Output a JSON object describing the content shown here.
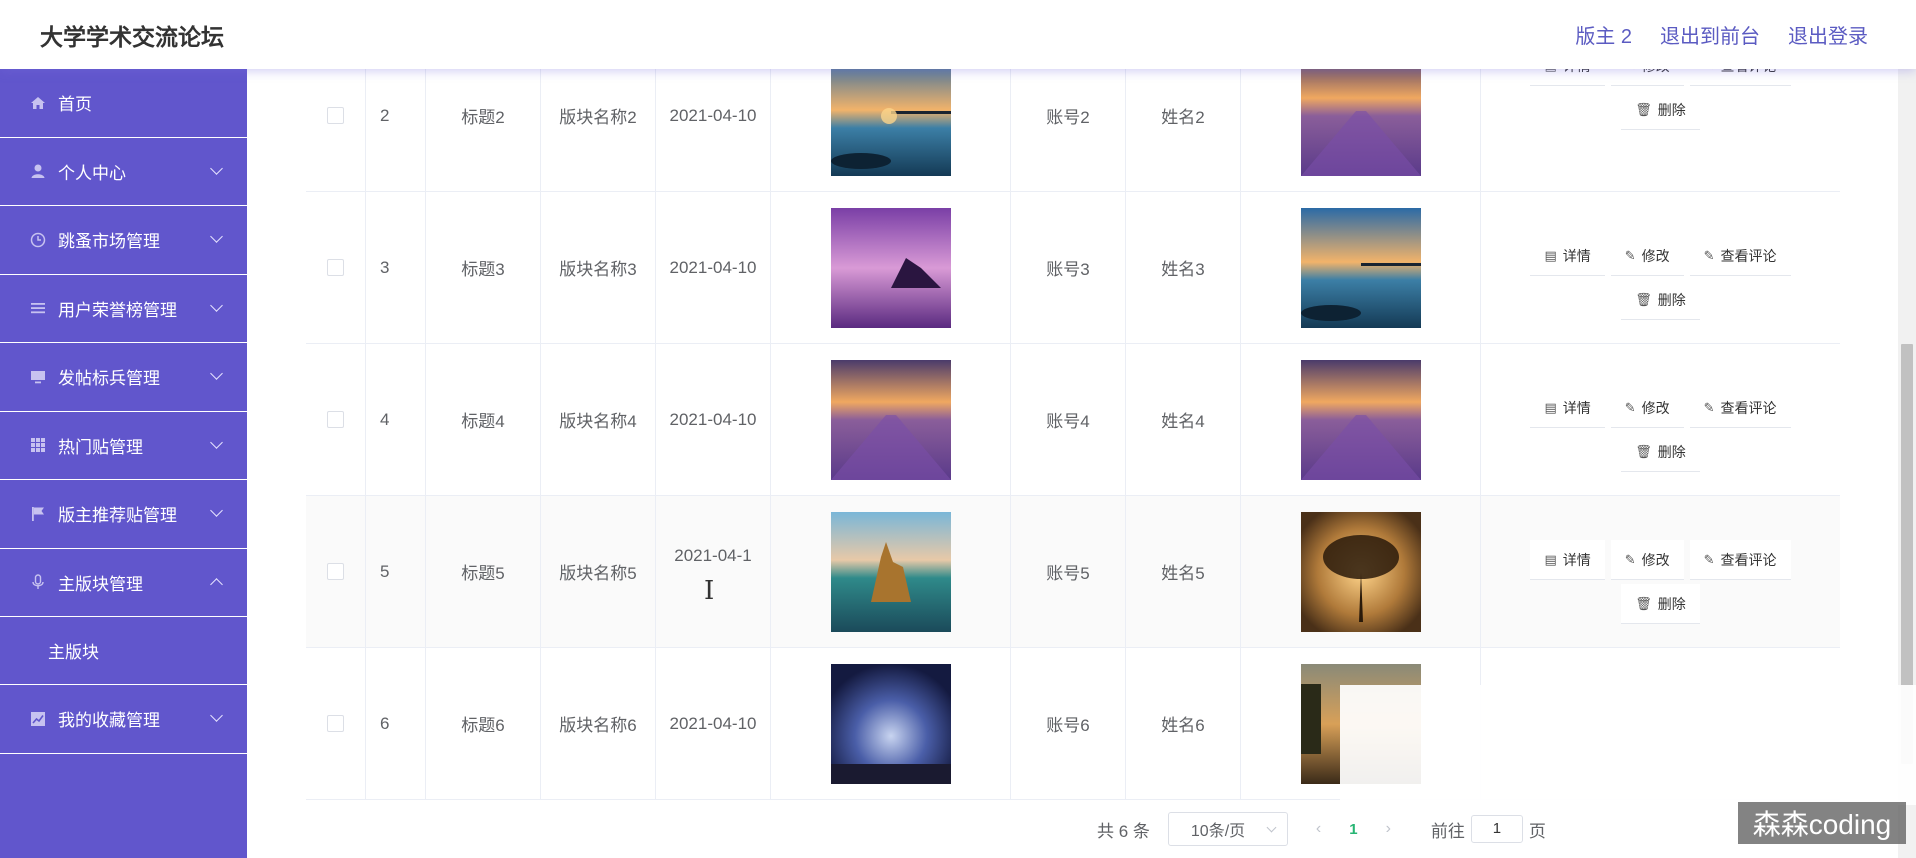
{
  "header": {
    "title": "大学学术交流论坛",
    "nav": [
      "版主 2",
      "退出到前台",
      "退出登录"
    ]
  },
  "sidebar": {
    "items": [
      {
        "label": "首页",
        "icon": "home-icon"
      },
      {
        "label": "个人中心",
        "icon": "user-icon"
      },
      {
        "label": "跳蚤市场管理",
        "icon": "clock-icon"
      },
      {
        "label": "用户荣誉榜管理",
        "icon": "list-icon"
      },
      {
        "label": "发帖标兵管理",
        "icon": "monitor-icon"
      },
      {
        "label": "热门贴管理",
        "icon": "grid-icon"
      },
      {
        "label": "版主推荐贴管理",
        "icon": "flag-icon"
      },
      {
        "label": "主版块管理",
        "icon": "mic-icon"
      },
      {
        "label": "我的收藏管理",
        "icon": "chart-icon"
      }
    ],
    "submenu_label": "主版块"
  },
  "table": {
    "rows": [
      {
        "idx": "2",
        "title": "标题2",
        "section": "版块名称2",
        "date": "2021-04-10",
        "account": "账号2",
        "name": "姓名2"
      },
      {
        "idx": "3",
        "title": "标题3",
        "section": "版块名称3",
        "date": "2021-04-10",
        "account": "账号3",
        "name": "姓名3"
      },
      {
        "idx": "4",
        "title": "标题4",
        "section": "版块名称4",
        "date": "2021-04-10",
        "account": "账号4",
        "name": "姓名4"
      },
      {
        "idx": "5",
        "title": "标题5",
        "section": "版块名称5",
        "date": "2021-04-1",
        "account": "账号5",
        "name": "姓名5"
      },
      {
        "idx": "6",
        "title": "标题6",
        "section": "版块名称6",
        "date": "2021-04-10",
        "account": "账号6",
        "name": "姓名6"
      }
    ],
    "ops": {
      "detail": "详情",
      "edit": "修改",
      "comments": "查看评论",
      "delete": "删除"
    }
  },
  "pagination": {
    "total": "共 6 条",
    "page_size": "10条/页",
    "current": "1",
    "goto_label": "前往",
    "goto_value": "1",
    "page_suffix": "页"
  },
  "watermark": "森森coding",
  "colors": {
    "sidebar": "#6156cc",
    "nav_link": "#5b5bc2",
    "active_page": "#27b574"
  }
}
